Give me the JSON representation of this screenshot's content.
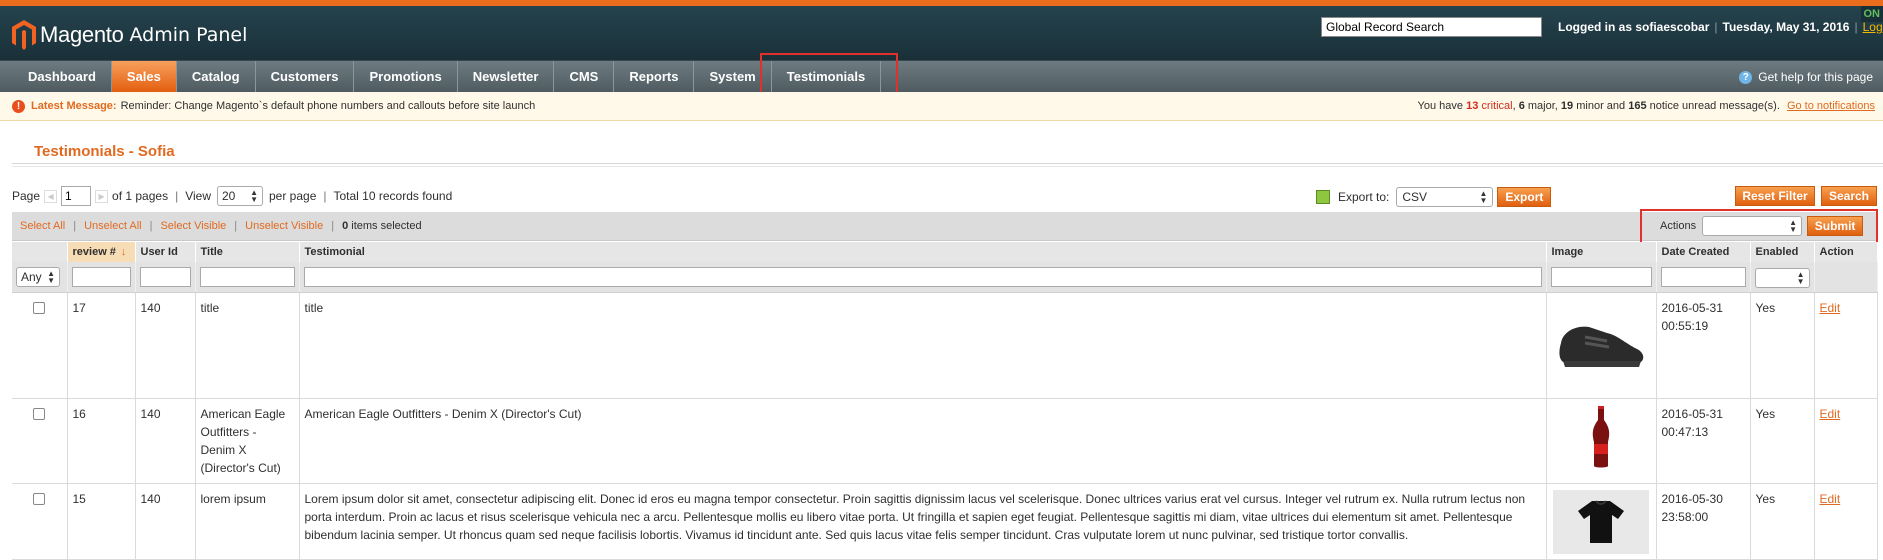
{
  "header": {
    "brand": "Magento",
    "subtitle": "Admin Panel",
    "search_value": "Global Record Search",
    "logged_in": "Logged in as sofiaescobar",
    "date": "Tuesday, May 31, 2016",
    "logout": "Log Out",
    "badge": "ON"
  },
  "nav": {
    "items": [
      {
        "label": "Dashboard"
      },
      {
        "label": "Sales"
      },
      {
        "label": "Catalog"
      },
      {
        "label": "Customers"
      },
      {
        "label": "Promotions"
      },
      {
        "label": "Newsletter"
      },
      {
        "label": "CMS"
      },
      {
        "label": "Reports"
      },
      {
        "label": "System"
      },
      {
        "label": "Testimonials"
      }
    ],
    "help": "Get help for this page"
  },
  "message": {
    "label": "Latest Message:",
    "text": "Reminder: Change Magento`s default phone numbers and callouts before site launch",
    "summary_prefix": "You have",
    "critical_count": "13",
    "critical_word": "critical",
    "major_count": "6",
    "major_word": "major",
    "minor_count": "19",
    "minor_word": "minor and",
    "notice_count": "165",
    "notice_word": "notice unread message(s).",
    "link": "Go to notifications"
  },
  "page": {
    "title": "Testimonials - Sofia"
  },
  "pager": {
    "page_label": "Page",
    "page_value": "1",
    "of_pages": "of 1 pages",
    "view_label": "View",
    "per_page_value": "20",
    "per_page_label": "per page",
    "total": "Total 10 records found"
  },
  "export": {
    "label": "Export to:",
    "format": "CSV",
    "button": "Export"
  },
  "buttons": {
    "reset": "Reset Filter",
    "search": "Search",
    "submit": "Submit"
  },
  "massaction": {
    "select_all": "Select All",
    "unselect_all": "Unselect All",
    "select_visible": "Select Visible",
    "unselect_visible": "Unselect Visible",
    "count": "0",
    "count_label": "items selected",
    "actions_label": "Actions"
  },
  "columns": {
    "review": "review #",
    "user_id": "User Id",
    "title": "Title",
    "testimonial": "Testimonial",
    "image": "Image",
    "date_created": "Date Created",
    "enabled": "Enabled",
    "action": "Action"
  },
  "filters": {
    "any": "Any"
  },
  "rows": [
    {
      "review": "17",
      "user_id": "140",
      "title": "title",
      "testimonial": "title",
      "image_icon": "sneaker-icon",
      "date": "2016-05-31",
      "time": "00:55:19",
      "enabled": "Yes",
      "action": "Edit"
    },
    {
      "review": "16",
      "user_id": "140",
      "title": "American Eagle Outfitters - Denim X (Director's Cut)",
      "testimonial": "American Eagle Outfitters - Denim X (Director's Cut)",
      "image_icon": "bottle-icon",
      "date": "2016-05-31",
      "time": "00:47:13",
      "enabled": "Yes",
      "action": "Edit"
    },
    {
      "review": "15",
      "user_id": "140",
      "title": "lorem ipsum",
      "testimonial": "Lorem ipsum dolor sit amet, consectetur adipiscing elit. Donec id eros eu magna tempor consectetur. Proin sagittis dignissim lacus vel scelerisque. Donec ultrices varius erat vel cursus. Integer vel rutrum ex. Nulla rutrum lectus non porta interdum. Proin ac lacus et risus scelerisque vehicula nec a arcu. Pellentesque mollis eu libero vitae porta. Ut fringilla et sapien eget feugiat. Pellentesque sagittis mi diam, vitae ultrices dui elementum sit amet. Pellentesque bibendum lacinia semper. Ut rhoncus quam sed neque facilisis lobortis. Vivamus id tincidunt ante. Sed quis lacus vitae felis semper tincidunt. Cras vulputate lorem ut nunc pulvinar, sed tristique tortor convallis.",
      "image_icon": "tshirt-icon",
      "date": "2016-05-30",
      "time": "23:58:00",
      "enabled": "Yes",
      "action": "Edit"
    }
  ],
  "colors": {
    "accent": "#e16a21",
    "header": "#1f3a44",
    "nav": "#5e6a70",
    "highlight": "#e0312d"
  }
}
